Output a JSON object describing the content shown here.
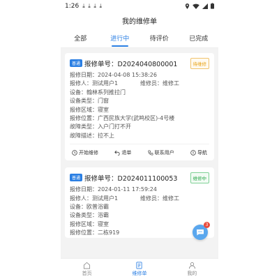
{
  "status_bar": {
    "time": "1:26",
    "download_icons": "⤓ ⤓ ⤓ ⤓"
  },
  "title": "我的维修单",
  "tabs": [
    {
      "label": "全部",
      "active": false
    },
    {
      "label": "进行中",
      "active": true
    },
    {
      "label": "待评价",
      "active": false
    },
    {
      "label": "已完成",
      "active": false
    }
  ],
  "orders": [
    {
      "type_badge": "普通",
      "order_no": "报修单号：D2024040800001",
      "status": "待维修",
      "status_kind": "pending",
      "date": "报修日期：2024-04-08 15:38:26",
      "reporter": "报修人：测试用户1",
      "repairer": "维修员：维修工",
      "device": "设备：翰林系列推拉门",
      "device_type": "设备类型：门窗",
      "area": "报修区域：寝室",
      "location": "报修位置：广西民族大学(武鸣校区)-4号楼",
      "fault_type": "故障类型：入户门打不开",
      "fault_desc": "故障描述：拉不上",
      "actions": {
        "start": "开始维修",
        "return": "退单",
        "contact": "联系用户",
        "navigate": "导航"
      }
    },
    {
      "type_badge": "普通",
      "order_no": "报修单号：D2024011100053",
      "status": "维修中",
      "status_kind": "repairing",
      "date": "报修日期：2024-01-11 17:59:24",
      "reporter": "报修人：测试用户1",
      "repairer": "维修员：维修工",
      "device": "设备：欧普浴霸",
      "device_type": "设备类型：浴霸",
      "area": "报修区域：寝室",
      "location": "报修位置：二栋919"
    }
  ],
  "fab": {
    "badge": "3"
  },
  "bottom_nav": [
    {
      "label": "首页",
      "icon": "home-icon",
      "active": false
    },
    {
      "label": "维修单",
      "icon": "order-icon",
      "active": true
    },
    {
      "label": "我的",
      "icon": "user-icon",
      "active": false
    }
  ],
  "colors": {
    "accent": "#2b7fe3",
    "pending": "#e8a317",
    "repairing": "#2aa84a"
  }
}
